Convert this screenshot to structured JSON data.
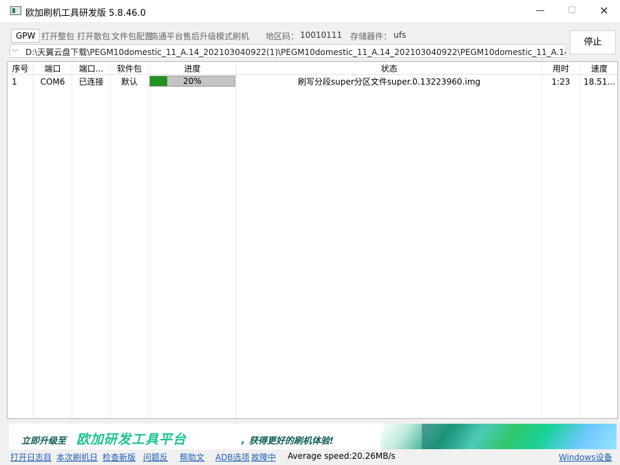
{
  "window": {
    "title": "欧加刷机工具研发版 5.8.46.0",
    "min_icon": "—",
    "max_icon": "☐",
    "close_icon": "✕"
  },
  "toolbar": {
    "gpw": "GPW",
    "open_whole": "打开整包",
    "open_scatter": "打开散包",
    "package_config": "文件包配置",
    "mode": "高通平台售后升级模式刷机",
    "region_label": "地区码：",
    "region_value": "10010111",
    "storage_label": "存储器件：",
    "storage_value": "ufs",
    "stop": "停止"
  },
  "path": {
    "value": "D:\\天翼云盘下载\\PEGM10domestic_11_A.14_202103040922(1)\\PEGM10domestic_11_A.14_202103040922\\PEGM10domestic_11_A.14_2021"
  },
  "table": {
    "headers": [
      "序号",
      "端口",
      "端口...",
      "软件包",
      "进度",
      "状态",
      "用时",
      "速度"
    ],
    "rows": [
      {
        "index": "1",
        "port": "COM6",
        "port_status": "已连接",
        "package": "默认",
        "progress_text": "20%",
        "progress": 0.2,
        "status": "刷写分段super分区文件super.0.13223960.img",
        "elapsed": "1:23",
        "speed": "18.51..."
      }
    ]
  },
  "banner": {
    "prefix": "立即升级至",
    "highlight": "欧加研发工具平台",
    "suffix": "，获得更好的刷机体验!"
  },
  "footer": {
    "open_log": "打开日志目",
    "this_log": "本次刷机日",
    "check_update": "检查新版",
    "feedback": "问题反",
    "help": "帮助文",
    "adb": "ADB选项",
    "fault": "故障中",
    "avg_speed": "Average speed:20.26MB/s",
    "windows_device": "Windows设备"
  },
  "colors": {
    "progress_fill": "#229222",
    "progress_bg": "#c4c4c4",
    "link": "#1f5fb2",
    "banner_highlight": "#1fc28f"
  }
}
